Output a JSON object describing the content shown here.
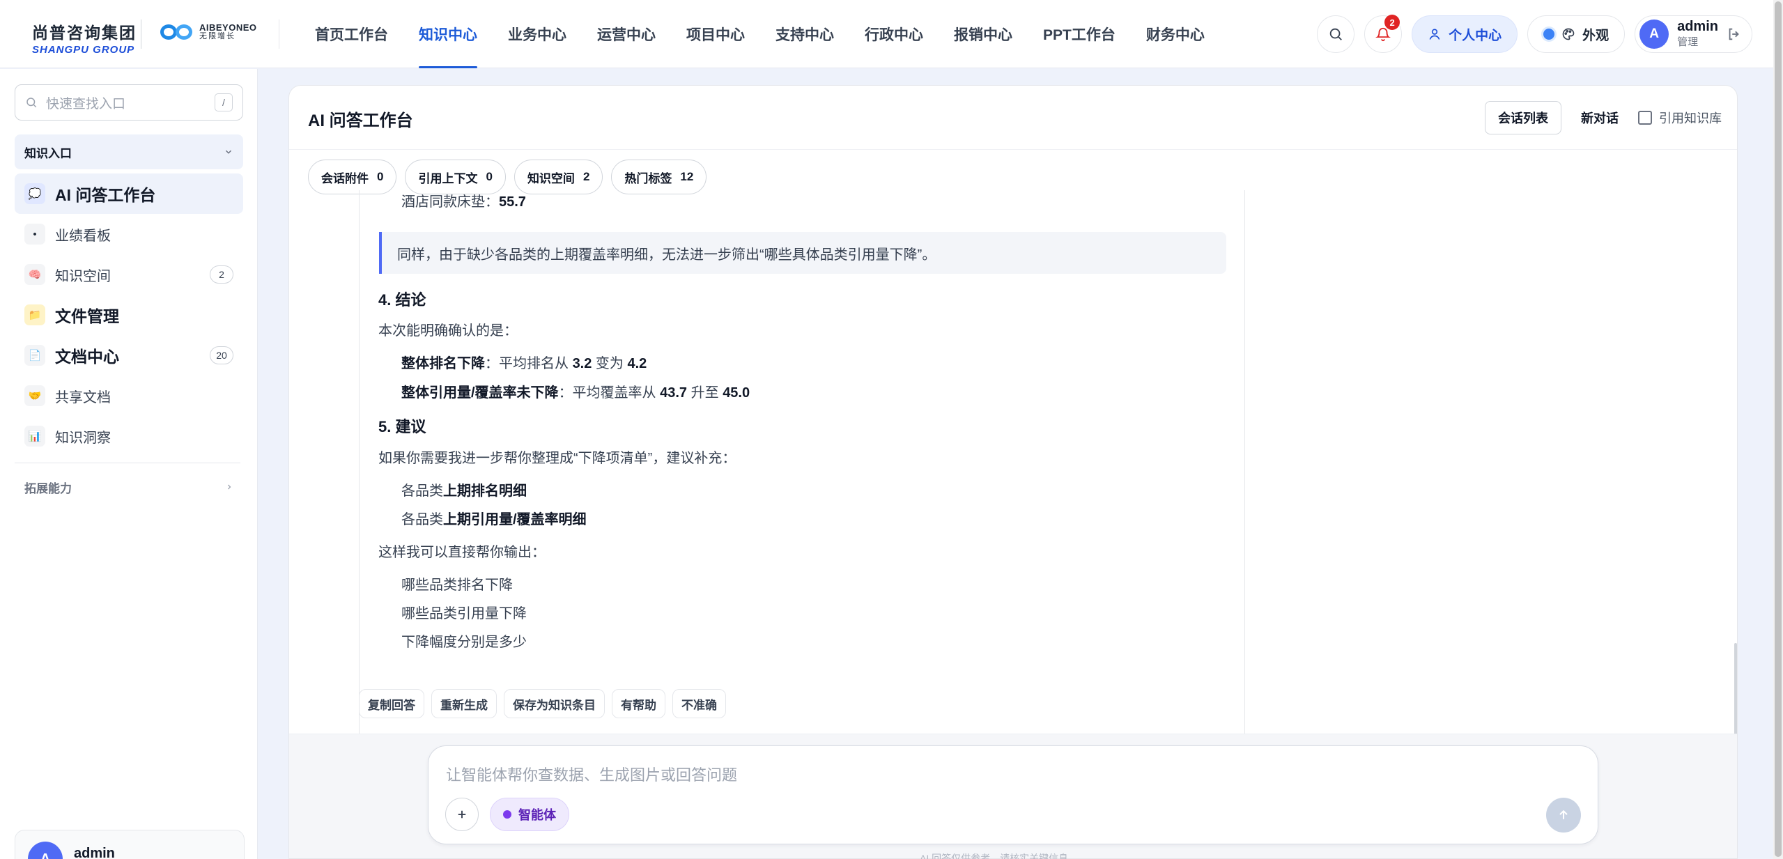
{
  "brand": {
    "cn": "尚普咨询集团",
    "en": "SHANGPU GROUP",
    "partner_en": "AIBEYONEO",
    "partner_cn": "无限增长"
  },
  "nav": {
    "items": [
      {
        "label": "首页工作台"
      },
      {
        "label": "知识中心",
        "active": true
      },
      {
        "label": "业务中心"
      },
      {
        "label": "运营中心"
      },
      {
        "label": "项目中心"
      },
      {
        "label": "支持中心"
      },
      {
        "label": "行政中心"
      },
      {
        "label": "报销中心"
      },
      {
        "label": "PPT工作台"
      },
      {
        "label": "财务中心"
      }
    ]
  },
  "topbar": {
    "notification_count": "2",
    "personal_label": "个人中心",
    "theme_label": "外观",
    "user_initial": "A",
    "user_name": "admin",
    "user_role": "管理"
  },
  "sidebar": {
    "search_placeholder": "快速查找入口",
    "search_shortcut": "/",
    "section_title": "知识入口",
    "items": [
      {
        "label": "AI 问答工作台",
        "icon": "💭",
        "icon_name": "chat-bubble-icon",
        "big": true,
        "active": true
      },
      {
        "label": "业绩看板",
        "icon": "•",
        "icon_name": "dot-icon"
      },
      {
        "label": "知识空间",
        "icon": "🧠",
        "icon_name": "brain-icon",
        "count": "2"
      },
      {
        "label": "文件管理",
        "icon": "📁",
        "icon_name": "folder-icon",
        "big": true
      },
      {
        "label": "文档中心",
        "icon": "📄",
        "icon_name": "document-icon",
        "big": true,
        "count": "20"
      },
      {
        "label": "共享文档",
        "icon": "🤝",
        "icon_name": "handshake-icon"
      },
      {
        "label": "知识洞察",
        "icon": "📊",
        "icon_name": "bar-chart-icon"
      }
    ],
    "extension_title": "拓展能力",
    "user_initial": "A",
    "user_name": "admin"
  },
  "panel": {
    "title": "AI 问答工作台",
    "session_list": "会话列表",
    "new_chat": "新对话",
    "cite_kb": "引用知识库",
    "chips": [
      {
        "label": "会话附件",
        "count": "0"
      },
      {
        "label": "引用上下文",
        "count": "0"
      },
      {
        "label": "知识空间",
        "count": "2"
      },
      {
        "label": "热门标签",
        "count": "12"
      }
    ]
  },
  "answer": {
    "line_top_label": "酒店同款床垫：",
    "line_top_value": "55.7",
    "quote": "同样，由于缺少各品类的上期覆盖率明细，无法进一步筛出“哪些具体品类引用量下降”。",
    "h4": "4. 结论",
    "p4": "本次能明确确认的是：",
    "b1_bold": "整体排名下降",
    "b1_text": "：平均排名从 ",
    "b1_v1": "3.2",
    "b1_mid": " 变为 ",
    "b1_v2": "4.2",
    "b2_bold": "整体引用量/覆盖率未下降",
    "b2_text": "：平均覆盖率从 ",
    "b2_v1": "43.7",
    "b2_mid": " 升至 ",
    "b2_v2": "45.0",
    "h5": "5. 建议",
    "p5": "如果你需要我进一步帮你整理成“下降项清单”，建议补充：",
    "s1_pre": "各品类",
    "s1_bold": "上期排名明细",
    "s2_pre": "各品类",
    "s2_bold": "上期引用量/覆盖率明细",
    "p6": "这样我可以直接帮你输出：",
    "o1": "哪些品类排名下降",
    "o2": "哪些品类引用量下降",
    "o3": "下降幅度分别是多少"
  },
  "actions": [
    "复制回答",
    "重新生成",
    "保存为知识条目",
    "有帮助",
    "不准确"
  ],
  "composer": {
    "placeholder": "让智能体帮你查数据、生成图片或回答问题",
    "agent_label": "智能体",
    "footer_hint": "AI 回答仅供参考，请核实关键信息"
  }
}
